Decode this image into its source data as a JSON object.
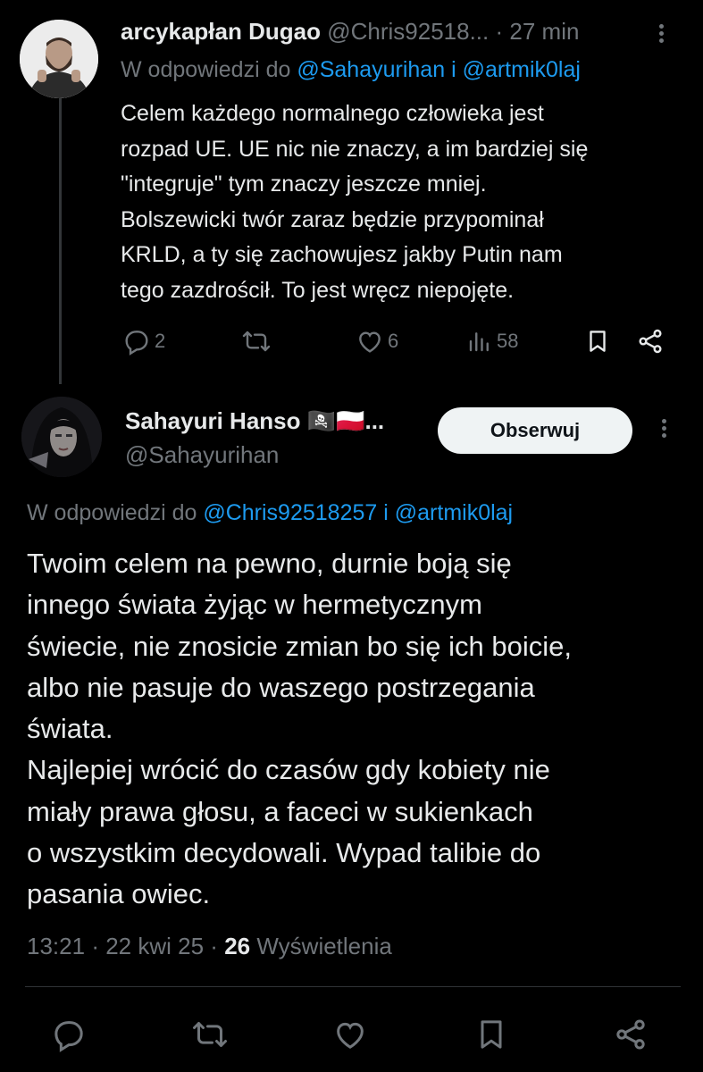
{
  "reply_tweet": {
    "display_name": "arcykapłan Dugao",
    "handle": "@Chris92518...",
    "separator": "·",
    "time": "27 min",
    "reply_prefix": "W odpowiedzi do",
    "reply_to_1": "@Sahayurihan",
    "reply_and": "i",
    "reply_to_2": "@artmik0laj",
    "text": "Celem każdego normalnego człowieka jest\nrozpad UE. UE nic nie znaczy, a im bardziej się\n\"integruje\" tym znaczy jeszcze mniej.\nBolszewicki twór zaraz będzie przypominał\nKRLD, a ty się zachowujesz jakby Putin nam\ntego zazdrościł. To jest wręcz niepojęte.",
    "actions": {
      "replies": "2",
      "likes": "6",
      "views": "58"
    }
  },
  "main_tweet": {
    "display_name": "Sahayuri Hanso 🏴‍☠️🇵🇱...",
    "handle": "@Sahayurihan",
    "follow_label": "Obserwuj",
    "reply_prefix": "W odpowiedzi do",
    "reply_to_1": "@Chris92518257",
    "reply_and": "i",
    "reply_to_2": "@artmik0laj",
    "text": "Twoim celem na pewno, durnie boją się\ninnego świata żyjąc w hermetycznym\nświecie, nie znosicie zmian bo się ich boicie,\nalbo nie pasuje do waszego postrzegania\nświata.\nNajlepiej wrócić do czasów gdy kobiety nie\nmiały prawa głosu, a faceci w sukienkach\no wszystkim decydowali. Wypad talibie do\npasania owiec.",
    "time": "13:21",
    "separator": "·",
    "date": "22 kwi 25",
    "views_count": "26",
    "views_label": "Wyświetlenia"
  }
}
